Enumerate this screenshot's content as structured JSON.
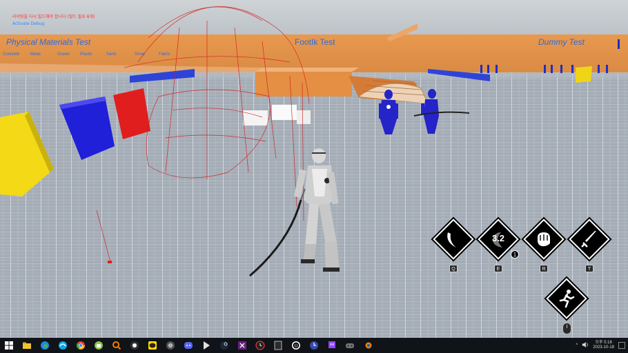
{
  "debug": {
    "rebuild_notice": "라이팅을 다시 빌드해야 합니다 (빌드 필요 8개)",
    "activate_debug": "Activate Debug"
  },
  "signs": {
    "physical_materials": "Physical Materials Test",
    "footik": "FootIk Test",
    "dummy": "Dummy Test",
    "material_labels": [
      "Concrete",
      "Metal",
      "Gravel",
      "Plastic",
      "Sand",
      "Snow",
      "Fabric"
    ]
  },
  "hud": {
    "skills": [
      {
        "icon": "crescent-slash-icon",
        "key": "Q"
      },
      {
        "icon": "moon-cooldown-icon",
        "key": "E",
        "cooldown": "3.2",
        "stack": "1"
      },
      {
        "icon": "fist-icon",
        "key": "R"
      },
      {
        "icon": "sword-icon",
        "key": "T"
      }
    ],
    "dash": {
      "icon": "running-man-icon"
    },
    "mouse_icon": "mouse-icon"
  },
  "taskbar": {
    "apps": [
      "windows-start-icon",
      "folder-icon",
      "edge-icon",
      "edge-alt-icon",
      "chrome-icon",
      "android-icon",
      "hand-icon",
      "joystick-icon",
      "kakaotalk-icon",
      "chrome-dev-icon",
      "discord-icon",
      "play-store-icon",
      "steam-icon",
      "visual-studio-icon",
      "rewind-icon",
      "epic-icon",
      "unreal-icon",
      "clock-icon",
      "twitch-icon",
      "controller-icon",
      "blender-icon"
    ],
    "tray": {
      "chevron": "^",
      "volume_icon": "volume-icon",
      "time": "오후 5:18",
      "date": "2023-10-18"
    }
  }
}
